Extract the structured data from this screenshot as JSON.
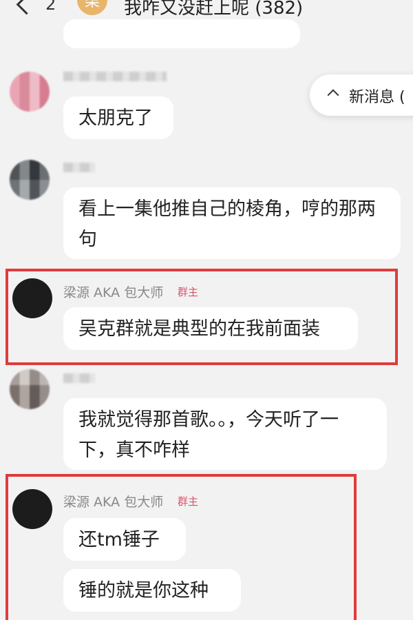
{
  "header": {
    "count": "2",
    "group_avatar_char": "柒",
    "title": "我咋又没赶上呢 (382)"
  },
  "new_message_button": {
    "label": "新消息 ("
  },
  "messages": [
    {
      "sender": "",
      "text": "太朋克了"
    },
    {
      "sender": "",
      "text": "看上一集他推自己的棱角，哼的那两句"
    },
    {
      "sender": "梁源 AKA 包大师",
      "badge": "群主",
      "text": "吴克群就是典型的在我前面装"
    },
    {
      "sender": "",
      "text": "我就觉得那首歌。。，今天听了一下，真不咋样"
    },
    {
      "sender": "梁源 AKA 包大师",
      "badge": "群主",
      "texts": [
        "还tm锤子",
        "锤的就是你这种"
      ]
    }
  ]
}
